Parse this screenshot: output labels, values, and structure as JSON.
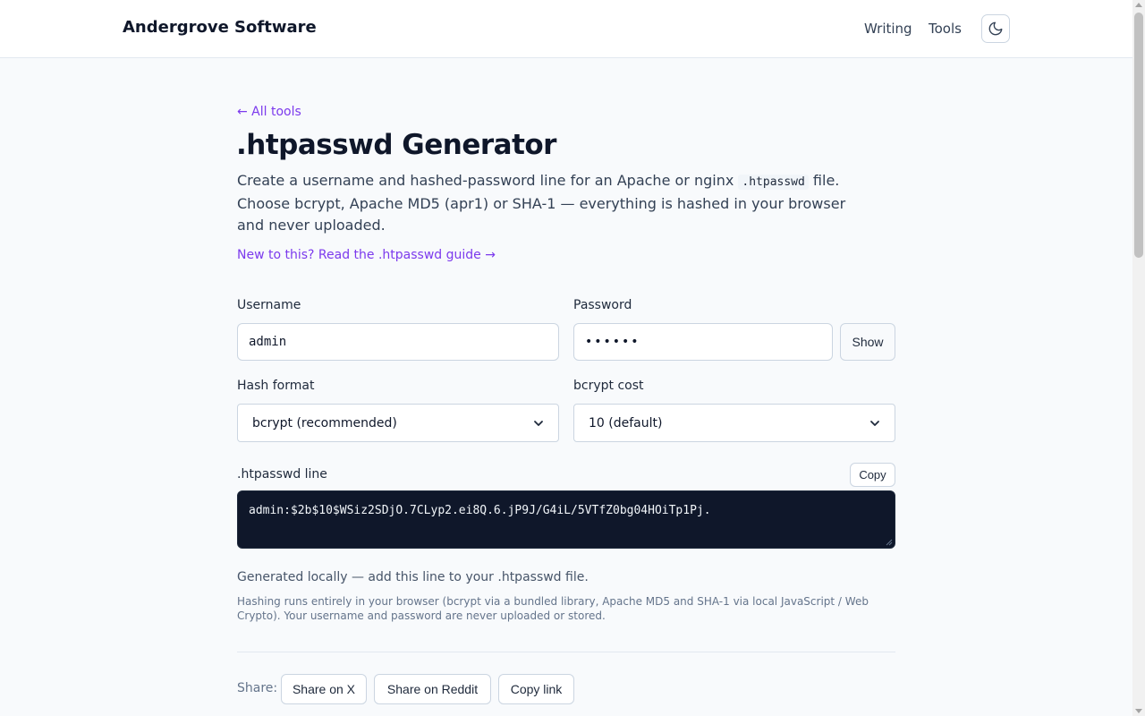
{
  "header": {
    "brand": "Andergrove Software",
    "nav": [
      {
        "label": "Writing"
      },
      {
        "label": "Tools"
      }
    ],
    "theme_toggle_icon": "moon-icon"
  },
  "main": {
    "back_link": "← All tools",
    "title": ".htpasswd Generator",
    "intro_part1": "Create a username and hashed-password line for an Apache or nginx ",
    "intro_code": ".htpasswd",
    "intro_part2": " file. Choose bcrypt, Apache MD5 (apr1) or SHA-1 — everything is hashed in your browser and never uploaded.",
    "guide_link": "New to this? Read the .htpasswd guide →"
  },
  "form": {
    "username_label": "Username",
    "username_value": "admin",
    "password_label": "Password",
    "password_value": "••••••",
    "show_button": "Show",
    "hash_format_label": "Hash format",
    "hash_format_value": "bcrypt (recommended)",
    "cost_label": "bcrypt cost",
    "cost_value": "10 (default)"
  },
  "output": {
    "label": ".htpasswd line",
    "copy_button": "Copy",
    "line": "admin:$2b$10$WSiz2SDjO.7CLyp2.ei8Q.6.jP9J/G4iL/5VTfZ0bg04HOiTp1Pj.",
    "note_main": "Generated locally — add this line to your .htpasswd file.",
    "note_small": "Hashing runs entirely in your browser (bcrypt via a bundled library, Apache MD5 and SHA-1 via local JavaScript / Web Crypto). Your username and password are never uploaded or stored."
  },
  "share": {
    "label": "Share:",
    "buttons": [
      {
        "label": "Share on X"
      },
      {
        "label": "Share on Reddit"
      },
      {
        "label": "Copy link"
      }
    ]
  },
  "colors": {
    "accent": "#7c3aed",
    "output_bg": "#0f172a",
    "page_bg": "#f8fafc"
  }
}
